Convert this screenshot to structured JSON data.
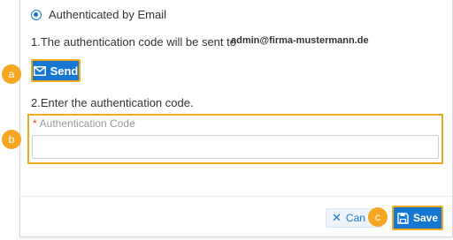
{
  "dialog": {
    "radio_option_label": "Authenticated by Email",
    "instruction1": "1.The authentication code will be sent to",
    "email": "admin@firma-mustermann.de",
    "send_label": "Send",
    "instruction2": "2.Enter the authentication code.",
    "auth_code_label": "Authentication Code",
    "auth_code_value": "",
    "cancel_label": "Can",
    "save_label": "Save"
  },
  "markers": {
    "a": "a",
    "b": "b",
    "c": "c"
  },
  "colors": {
    "primary": "#1677d3",
    "highlight": "#f0a81c",
    "marker": "#f5a623",
    "required": "#e53935"
  },
  "icons": {
    "radio": "radio-selected",
    "send": "envelope-icon",
    "cancel": "close-icon",
    "save": "floppy-disk-icon"
  }
}
